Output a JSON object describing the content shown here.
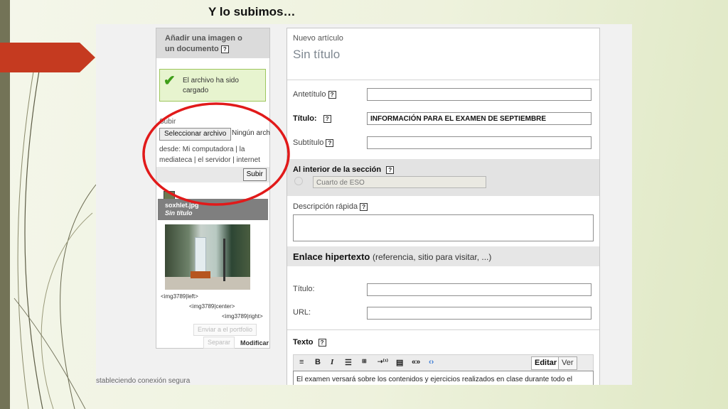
{
  "slide": {
    "title": "Y lo subimos…",
    "colors": {
      "accent": "#c53a20",
      "band": "#737357",
      "highlight": "#e11a1a"
    }
  },
  "browser": {
    "status_text": "stableciendo conexión segura"
  },
  "upload_panel": {
    "header": "Añadir una imagen o un documento",
    "help": "?",
    "success_message": "El archivo ha sido cargado",
    "subir_label": "Subir",
    "select_file_button": "Seleccionar archivo",
    "no_file_text": "Ningún arch",
    "desde_text": "desde: Mi computadora | la mediateca | el servidor | internet",
    "submit_button": "Subir",
    "attachment": {
      "filename": "soxhlet.jpg",
      "title": "Sin título",
      "codes": [
        "<img3789|left>",
        "<img3789|center>",
        "<img3789|right>"
      ],
      "send_button": "Enviar a el portfolio",
      "separate_button": "Separar",
      "modify_link": "Modificar"
    }
  },
  "article_form": {
    "new_article_label": "Nuevo artículo",
    "article_title": "Sin título",
    "fields": {
      "antetitulo": {
        "label": "Antetítulo",
        "value": ""
      },
      "titulo": {
        "label": "Título:",
        "value": "INFORMACIÓN PARA EL EXAMEN DE SEPTIEMBRE"
      },
      "subtitulo": {
        "label": "Subtítulo",
        "value": ""
      }
    },
    "section": {
      "label": "Al interior de la sección",
      "value": "Cuarto de ESO"
    },
    "description": {
      "label": "Descripción rápida",
      "value": ""
    },
    "link": {
      "heading": "Enlace hipertexto",
      "hint": "(referencia, sitio para visitar, ...)",
      "title_label": "Título:",
      "url_label": "URL:"
    },
    "text": {
      "label": "Texto",
      "tab_edit": "Editar",
      "tab_view": "Ver",
      "content": "El examen versará sobre los contenidos y ejercicios realizados en clase durante todo el curso."
    }
  }
}
